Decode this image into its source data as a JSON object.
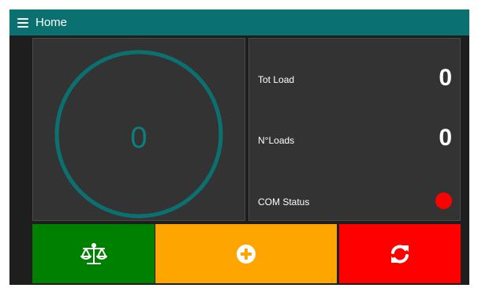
{
  "header": {
    "title": "Home"
  },
  "gauge": {
    "value": "0"
  },
  "stats": {
    "tot_load_label": "Tot Load",
    "tot_load_value": "0",
    "n_loads_label": "N°Loads",
    "n_loads_value": "0",
    "com_status_label": "COM Status",
    "com_status_color": "#ff0000"
  },
  "buttons": {
    "scale": {
      "icon": "balance-scale-icon",
      "color": "#008000"
    },
    "add": {
      "icon": "plus-circle-icon",
      "color": "#ffa500"
    },
    "reset": {
      "icon": "refresh-icon",
      "color": "#ff0000"
    }
  },
  "colors": {
    "accent": "#0b7070",
    "panel": "#333333",
    "background": "#1e1e1e"
  }
}
